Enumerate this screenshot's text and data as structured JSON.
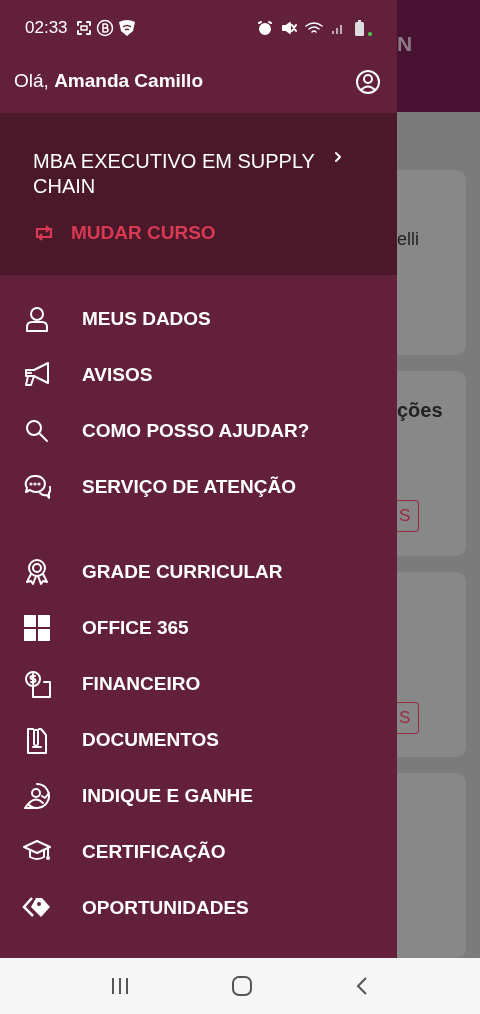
{
  "status_bar": {
    "time": "02:33"
  },
  "greeting": {
    "prefix": "Olá,",
    "name": "Amanda Camillo"
  },
  "course": {
    "title": "MBA EXECUTIVO EM SUPPLY CHAIN",
    "action": "MUDAR CURSO"
  },
  "menu_groups": [
    [
      {
        "label": "MEUS DADOS"
      },
      {
        "label": "AVISOS"
      },
      {
        "label": "COMO POSSO AJUDAR?"
      },
      {
        "label": "SERVIÇO DE ATENÇÃO"
      }
    ],
    [
      {
        "label": "GRADE CURRICULAR"
      },
      {
        "label": "OFFICE 365"
      },
      {
        "label": "FINANCEIRO"
      },
      {
        "label": "DOCUMENTOS"
      },
      {
        "label": "INDIQUE E GANHE"
      },
      {
        "label": "CERTIFICAÇÃO"
      },
      {
        "label": "OPORTUNIDADES"
      }
    ]
  ],
  "background": {
    "header_text": "N",
    "cards": [
      {
        "kind": "text",
        "text": "elli"
      },
      {
        "kind": "title",
        "title": "ções",
        "button": "S"
      },
      {
        "kind": "button",
        "button": "S"
      },
      {
        "kind": "plain"
      }
    ]
  }
}
